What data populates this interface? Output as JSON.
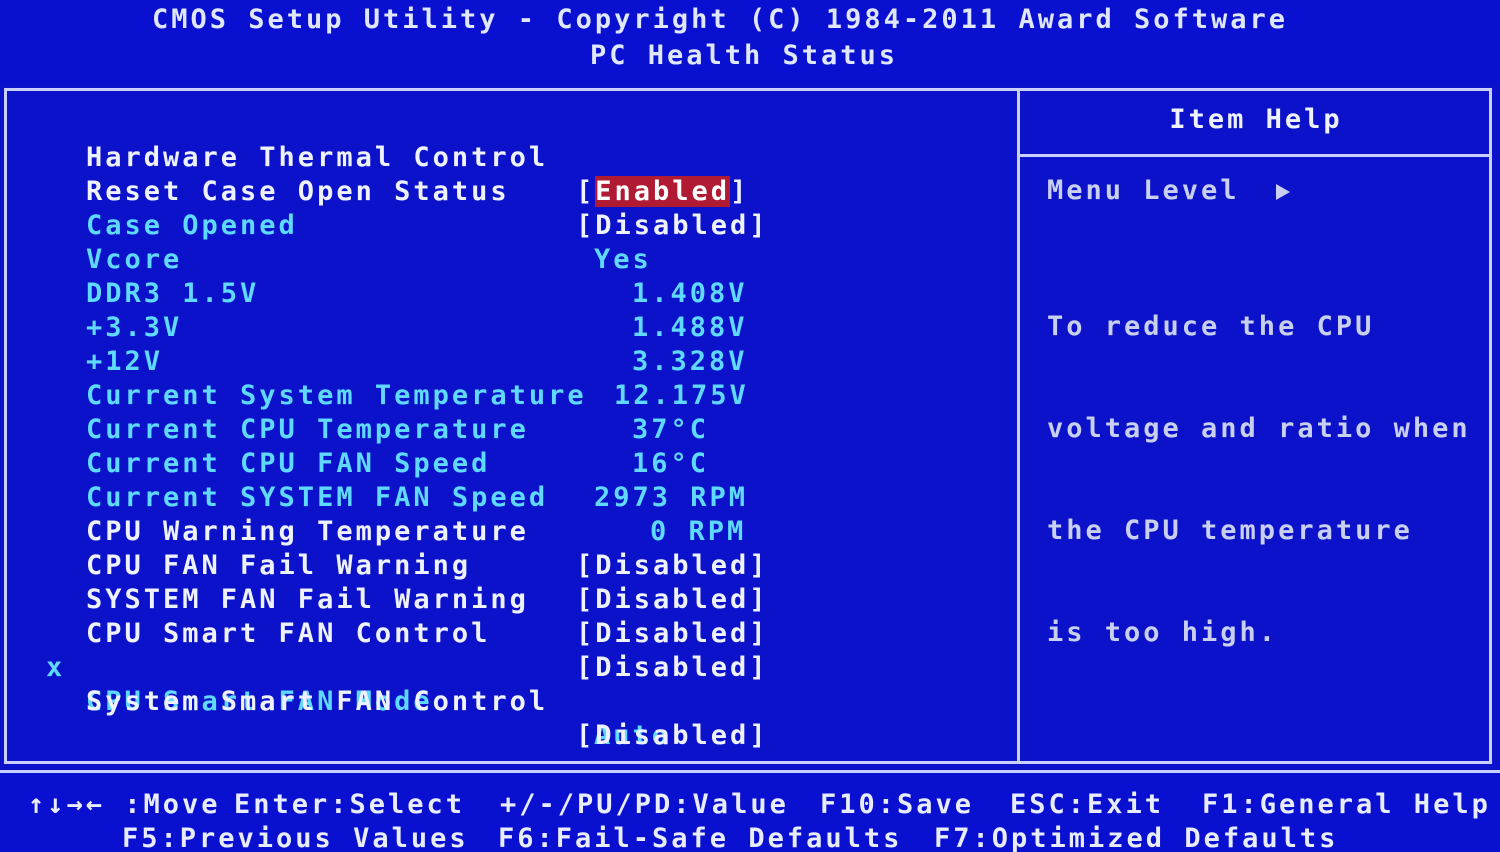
{
  "header": {
    "title": "CMOS Setup Utility - Copyright (C) 1984-2011 Award Software",
    "subtitle": "PC Health Status"
  },
  "items": [
    {
      "label": "Hardware Thermal Control",
      "value": "[Enabled]",
      "kind": "settable",
      "selected": true
    },
    {
      "label": "Reset Case Open Status",
      "value": "[Disabled]",
      "kind": "settable"
    },
    {
      "label": "Case Opened",
      "value": "Yes",
      "kind": "info"
    },
    {
      "label": "Vcore",
      "value": "1.408V",
      "kind": "info"
    },
    {
      "label": "DDR3 1.5V",
      "value": "1.488V",
      "kind": "info"
    },
    {
      "label": "+3.3V",
      "value": "3.328V",
      "kind": "info"
    },
    {
      "label": "+12V",
      "value": "12.175V",
      "kind": "info"
    },
    {
      "label": "Current System Temperature",
      "value": "37°C",
      "kind": "info"
    },
    {
      "label": "Current CPU Temperature",
      "value": "16°C",
      "kind": "info"
    },
    {
      "label": "Current CPU FAN Speed",
      "value": "2973 RPM",
      "kind": "info"
    },
    {
      "label": "Current SYSTEM FAN Speed",
      "value": "0 RPM",
      "kind": "info"
    },
    {
      "label": "CPU Warning Temperature",
      "value": "[Disabled]",
      "kind": "settable"
    },
    {
      "label": "CPU FAN Fail Warning",
      "value": "[Disabled]",
      "kind": "settable"
    },
    {
      "label": "SYSTEM FAN Fail Warning",
      "value": "[Disabled]",
      "kind": "settable"
    },
    {
      "label": "CPU Smart FAN Control",
      "value": "[Disabled]",
      "kind": "settable"
    },
    {
      "label": "CPU Smart FAN Mode",
      "value": "Auto",
      "kind": "locked",
      "marker": "x"
    },
    {
      "label": "System Smart FAN Control",
      "value": "[Disabled]",
      "kind": "settable"
    }
  ],
  "help": {
    "title": "Item Help",
    "menu_level": "Menu Level",
    "lines": [
      "To reduce the CPU",
      "voltage and ratio when",
      "the CPU temperature",
      "is too high."
    ]
  },
  "footer": {
    "move": "↑↓→← :Move",
    "enter": "Enter:Select",
    "value": "+/-/PU/PD:Value",
    "save": "F10:Save",
    "exit": "ESC:Exit",
    "help": "F1:General Help",
    "prev": "F5:Previous Values",
    "failsafe": "F6:Fail-Safe Defaults",
    "optimized": "F7:Optimized Defaults"
  },
  "colors": {
    "background": "#0b12c9",
    "settable_text": "#eef1ff",
    "info_text": "#5fd9ff",
    "highlight": "#b01a32"
  }
}
